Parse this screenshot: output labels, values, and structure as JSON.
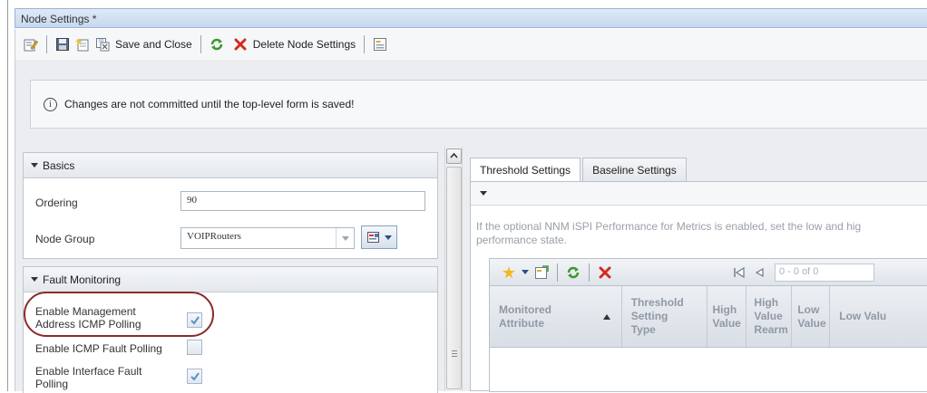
{
  "window": {
    "title": "Node Settings *"
  },
  "toolbar": {
    "save_close_label": "Save and Close",
    "delete_label": "Delete Node Settings"
  },
  "info": {
    "message": "Changes are not committed until the top-level form is saved!"
  },
  "basics": {
    "header": "Basics",
    "ordering_label": "Ordering",
    "ordering_value": "90",
    "node_group_label": "Node Group",
    "node_group_value": "VOIPRouters"
  },
  "fault": {
    "header": "Fault Monitoring",
    "items": [
      {
        "label_line1": "Enable Management",
        "label_line2": "Address ICMP Polling",
        "checked": true
      },
      {
        "label_line1": "Enable ICMP Fault Polling",
        "label_line2": "",
        "checked": false
      },
      {
        "label_line1": "Enable Interface Fault",
        "label_line2": "Polling",
        "checked": true
      }
    ]
  },
  "tabs": [
    {
      "label": "Threshold Settings",
      "active": true
    },
    {
      "label": "Baseline Settings",
      "active": false
    }
  ],
  "threshold": {
    "description_line1": "If the optional NNM iSPI Performance for Metrics is enabled, set the low and hig",
    "description_line2": "performance state.",
    "pager": "0 - 0 of 0",
    "columns": [
      {
        "line1": "Monitored",
        "line2": "Attribute",
        "line3": ""
      },
      {
        "line1": "Threshold",
        "line2": "Setting",
        "line3": "Type"
      },
      {
        "line1": "High",
        "line2": "Value",
        "line3": ""
      },
      {
        "line1": "High",
        "line2": "Value",
        "line3": "Rearm"
      },
      {
        "line1": "Low",
        "line2": "Value",
        "line3": ""
      },
      {
        "line1": "Low Valu",
        "line2": "",
        "line3": ""
      }
    ]
  },
  "colors": {
    "accent": "#99b4d6",
    "checkmark": "#5b8fc7",
    "highlight": "#8b2a2a",
    "delete": "#d42a1e",
    "refresh": "#3c9a2e"
  }
}
